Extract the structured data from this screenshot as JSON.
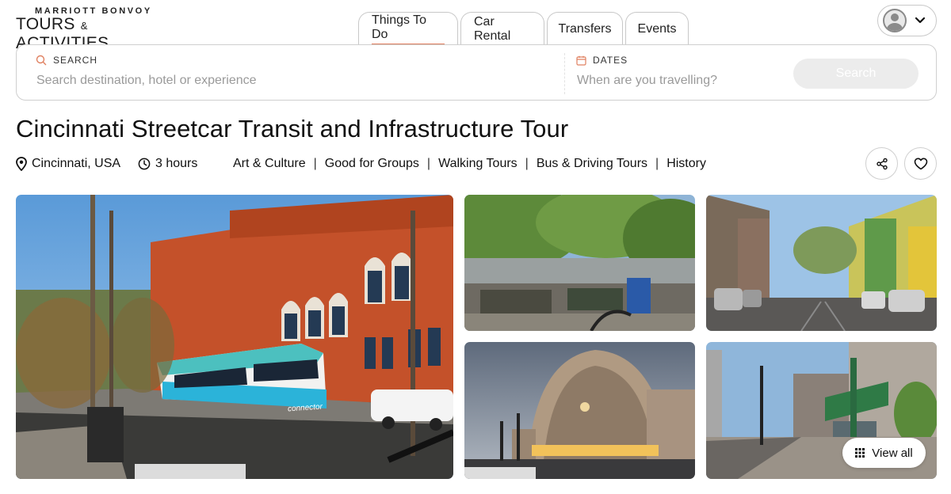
{
  "brand": {
    "top": "MARRIOTT BONVOY",
    "main_left": "TOURS",
    "amp": "&",
    "main_right": "ACTIVITIES"
  },
  "tabs": [
    {
      "label": "Things To Do",
      "active": true
    },
    {
      "label": "Car Rental",
      "active": false
    },
    {
      "label": "Transfers",
      "active": false
    },
    {
      "label": "Events",
      "active": false
    }
  ],
  "search": {
    "label": "SEARCH",
    "placeholder": "Search destination, hotel or experience",
    "dates_label": "DATES",
    "dates_placeholder": "When are you travelling?",
    "button": "Search"
  },
  "tour": {
    "title": "Cincinnati Streetcar Transit and Infrastructure Tour",
    "location": "Cincinnati, USA",
    "duration": "3 hours",
    "categories": [
      "Art & Culture",
      "Good for Groups",
      "Walking Tours",
      "Bus & Driving Tours",
      "History"
    ],
    "separator": "|"
  },
  "gallery": {
    "streetcar_logo": "connector",
    "view_all": "View all"
  },
  "colors": {
    "accent": "#e08060",
    "border": "#cfcfcf",
    "search_button_bg": "#ececec"
  },
  "icons": [
    "search-icon",
    "calendar-icon",
    "location-pin-icon",
    "clock-icon",
    "share-icon",
    "heart-icon",
    "grid-icon",
    "chevron-down-icon",
    "avatar-icon"
  ]
}
